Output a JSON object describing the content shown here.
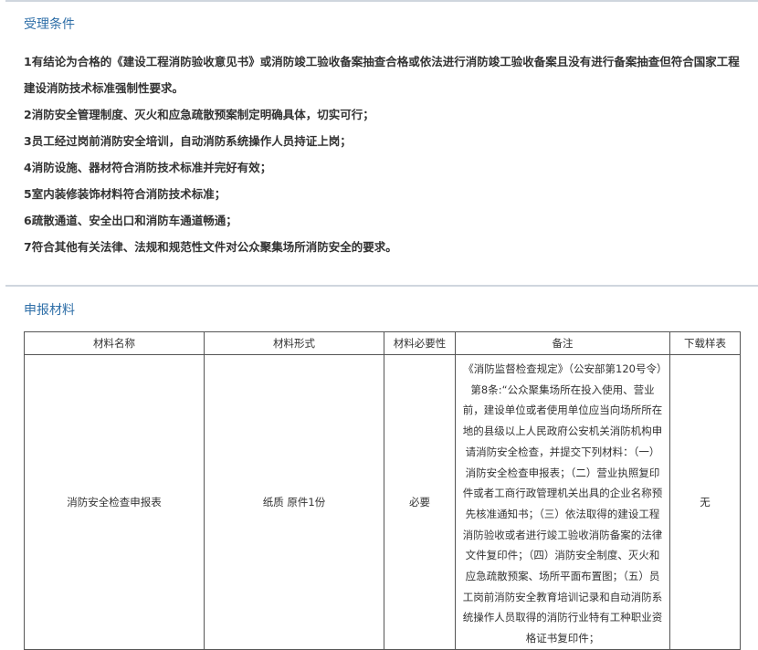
{
  "sections": {
    "conditions": {
      "title": "受理条件",
      "items": [
        "1有结论为合格的《建设工程消防验收意见书》或消防竣工验收备案抽查合格或依法进行消防竣工验收备案且没有进行备案抽查但符合国家工程建设消防技术标准强制性要求。",
        "2消防安全管理制度、灭火和应急疏散预案制定明确具体，切实可行；",
        "3员工经过岗前消防安全培训，自动消防系统操作人员持证上岗；",
        "4消防设施、器材符合消防技术标准并完好有效；",
        "5室内装修装饰材料符合消防技术标准；",
        "6疏散通道、安全出口和消防车通道畅通；",
        "7符合其他有关法律、法规和规范性文件对公众聚集场所消防安全的要求。"
      ]
    },
    "materials": {
      "title": "申报材料",
      "columns": [
        "材料名称",
        "材料形式",
        "材料必要性",
        "备注",
        "下载样表"
      ],
      "rows": [
        {
          "name": "消防安全检查申报表",
          "form": "纸质 原件1份",
          "necessity": "必要",
          "notes": "《消防监督检查规定》（公安部第120号令）第8条:“公众聚集场所在投入使用、营业前，建设单位或者使用单位应当向场所所在地的县级以上人民政府公安机关消防机构申请消防安全检查，并提交下列材料：（一）消防安全检查申报表；（二）营业执照复印件或者工商行政管理机关出具的企业名称预先核准通知书；（三）依法取得的建设工程消防验收或者进行竣工验收消防备案的法律文件复印件；（四）消防安全制度、灭火和应急疏散预案、场所平面布置图；（五）员工岗前消防安全教育培训记录和自动消防系统操作人员取得的消防行业特有工种职业资格证书复印件；",
          "download": "无"
        }
      ]
    }
  }
}
